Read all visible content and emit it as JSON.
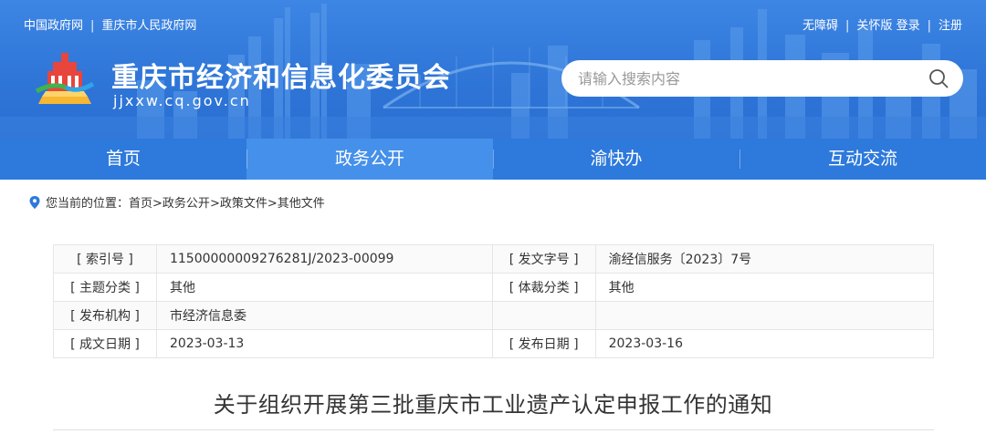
{
  "top_links_left": {
    "link1": "中国政府网",
    "sep": "|",
    "link2": "重庆市人民政府网"
  },
  "top_links_right": {
    "accessibility": "无障碍",
    "sep1": "|",
    "care": "关怀版",
    "login": "登录",
    "sep2": "|",
    "register": "注册"
  },
  "site": {
    "title": "重庆市经济和信息化委员会",
    "domain": "jjxxw.cq.gov.cn"
  },
  "search": {
    "placeholder": "请输入搜索内容",
    "value": ""
  },
  "nav": {
    "items": [
      "首页",
      "政务公开",
      "渝快办",
      "互动交流"
    ],
    "active": "政务公开"
  },
  "breadcrumb": {
    "prefix": "您当前的位置：",
    "items": [
      "首页",
      ">政务公开",
      ">政策文件",
      ">其他文件"
    ]
  },
  "meta": {
    "rows": [
      {
        "k1": "[ 索引号 ]",
        "v1": "11500000009276281J/2023-00099",
        "k2": "[ 发文字号 ]",
        "v2": "渝经信服务〔2023〕7号"
      },
      {
        "k1": "[ 主题分类 ]",
        "v1": "其他",
        "k2": "[ 体裁分类 ]",
        "v2": "其他"
      },
      {
        "k1": "[ 发布机构 ]",
        "v1": "市经济信息委",
        "k2": "",
        "v2": ""
      },
      {
        "k1": "[ 成文日期 ]",
        "v1": "2023-03-13",
        "k2": "[ 发布日期 ]",
        "v2": "2023-03-16"
      }
    ]
  },
  "document": {
    "title": "关于组织开展第三批重庆市工业遗产认定申报工作的通知"
  },
  "colors": {
    "header_blue": "#2f76d8",
    "nav_blue": "#2d79dc",
    "nav_active": "#4590ea"
  }
}
